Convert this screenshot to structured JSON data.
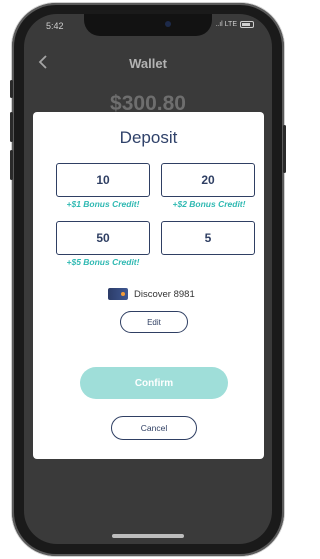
{
  "status_bar": {
    "time": "5:42",
    "icons": "..ıl LTE"
  },
  "nav": {
    "back_icon": "chevron-left-icon",
    "title": "Wallet"
  },
  "balance": "$300.80",
  "modal": {
    "title": "Deposit",
    "amounts": [
      {
        "value": "10",
        "bonus": "+$1 Bonus Credit!"
      },
      {
        "value": "20",
        "bonus": "+$2 Bonus Credit!"
      },
      {
        "value": "50",
        "bonus": "+$5 Bonus Credit!"
      },
      {
        "value": "5",
        "bonus": ""
      }
    ],
    "payment_method": {
      "icon": "credit-card-icon",
      "label": "Discover 8981"
    },
    "edit_label": "Edit",
    "confirm_label": "Confirm",
    "cancel_label": "Cancel"
  },
  "colors": {
    "accent": "#2fb9b2",
    "confirm_bg": "#9fded9",
    "navy": "#2f3f63",
    "overlay": "#3a3a3a"
  }
}
